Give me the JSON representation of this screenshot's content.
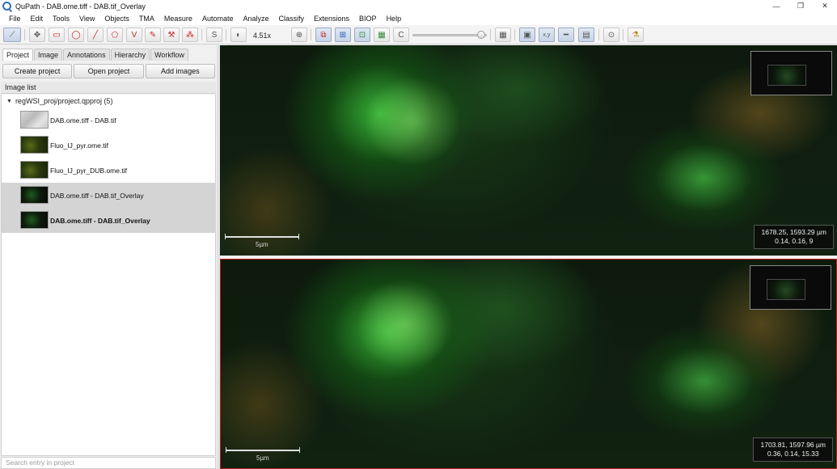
{
  "window": {
    "title": "QuPath - DAB.ome.tiff - DAB.tif_Overlay",
    "controls": {
      "minimize": "—",
      "restore": "❐",
      "close": "✕"
    }
  },
  "menu": [
    "File",
    "Edit",
    "Tools",
    "View",
    "Objects",
    "TMA",
    "Measure",
    "Automate",
    "Analyze",
    "Classify",
    "Extensions",
    "BIOP",
    "Help"
  ],
  "toolbar": {
    "zoom": "4.51x",
    "glyphs": {
      "move": "✥",
      "rectangle": "▭",
      "ellipse": "◯",
      "line": "╱",
      "polygon": "⬠",
      "polyline": "V",
      "brush": "✎",
      "wand": "⚒",
      "points": "⁂",
      "selection": "S",
      "contrast": "◐",
      "zoom_to_fit": "⊕",
      "show_annotations": "⧉",
      "show_tma": "⊞",
      "show_detections": "⊡",
      "fill_detections": "▦",
      "show_connections": "C",
      "grid": "▦",
      "overview": "▣",
      "location": "x,y",
      "scalebar": "━",
      "counting_grid": "▤",
      "pixel_classification": "⊙",
      "log": "⚗"
    }
  },
  "left_panel": {
    "tabs": [
      "Project",
      "Image",
      "Annotations",
      "Hierarchy",
      "Workflow"
    ],
    "selected_tab": "Project",
    "buttons": {
      "create": "Create project",
      "open": "Open project",
      "add": "Add images"
    },
    "section_title": "Image list",
    "project_root": "regWSI_proj/project.qpproj (5)",
    "entries": [
      {
        "name": "DAB.ome.tiff - DAB.tif",
        "thumb": "dab",
        "selected": false,
        "bold": false
      },
      {
        "name": "Fluo_IJ_pyr.ome.tif",
        "thumb": "fluo",
        "selected": false,
        "bold": false
      },
      {
        "name": "Fluo_IJ_pyr_DUB.ome.tif",
        "thumb": "fluo",
        "selected": false,
        "bold": false
      },
      {
        "name": "DAB.ome.tiff - DAB.tif_Overlay",
        "thumb": "overlay",
        "selected": true,
        "bold": false
      },
      {
        "name": "DAB.ome.tiff - DAB.tif_Overlay",
        "thumb": "overlay",
        "selected": true,
        "bold": true
      }
    ],
    "search_placeholder": "Search entry in project"
  },
  "viewers": [
    {
      "scale": "5µm",
      "coords_line1": "1678.25, 1593.29 µm",
      "coords_line2": "0.14, 0.16, 9"
    },
    {
      "scale": "5µm",
      "coords_line1": "1703.81, 1597.96 µm",
      "coords_line2": "0.36, 0.14, 15.33"
    }
  ],
  "colors": {
    "active_viewer_border": "#b81d1d",
    "tool_red": "#c62828",
    "tool_blue": "#2a56b8",
    "tool_green": "#2c8b3a"
  }
}
